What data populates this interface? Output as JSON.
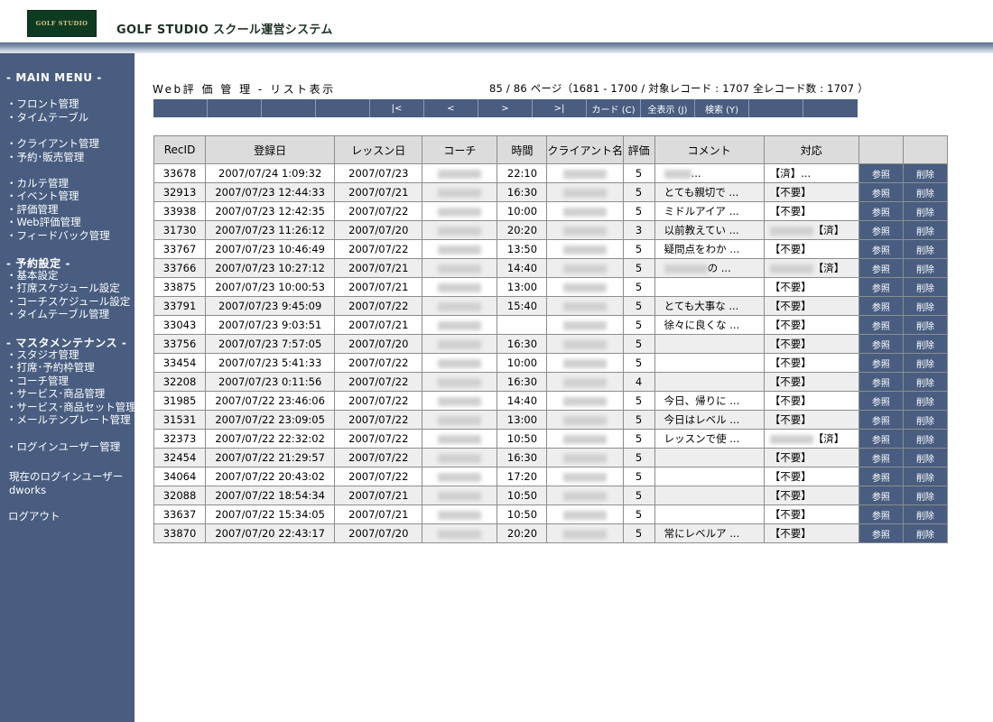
{
  "header": {
    "logo_text": "GOLF STUDIO",
    "app_title": "GOLF STUDIO スクール運営システム"
  },
  "sidebar": {
    "main_menu": "- MAIN MENU -",
    "group1": [
      "・フロント管理",
      "・タイムテーブル"
    ],
    "group2": [
      "・クライアント管理",
      "・予約･販売管理"
    ],
    "group3": [
      "・カルテ管理",
      "・イベント管理",
      "・評価管理",
      "・Web評価管理",
      "・フィードバック管理"
    ],
    "settings_head": "- 予約設定 -",
    "group4": [
      "・基本設定",
      "・打席スケジュール設定",
      "・コーチスケジュール設定",
      "・タイムテーブル管理"
    ],
    "master_head": "- マスタメンテナンス -",
    "group5": [
      "・スタジオ管理",
      "・打席･予約枠管理",
      "・コーチ管理",
      "・サービス･商品管理",
      "・サービス･商品セット管理",
      "・メールテンプレート管理"
    ],
    "login_user_mgmt": "・ログインユーザー管理",
    "current_user_label": "現在のログインユーザー",
    "current_user": "dworks",
    "logout": "ログアウト"
  },
  "main": {
    "title": "Web評 価 管 理 - リスト表示",
    "page_info": "85 / 86 ページ（1681 - 1700 / 対象レコード : 1707 全レコード数 : 1707 ）",
    "nav": [
      "",
      "",
      "",
      "",
      "|<",
      "<",
      ">",
      ">|",
      "カード (C)",
      "全表示 (J)",
      "検索 (Y)",
      "",
      ""
    ],
    "columns": [
      "RecID",
      "登録日",
      "レッスン日",
      "コーチ",
      "時間",
      "クライアント名",
      "評価",
      "コメント",
      "対応",
      "",
      ""
    ],
    "ref_label": "参照",
    "del_label": "削除",
    "rows": [
      {
        "id": "33678",
        "reg": "2007/07/24 1:09:32",
        "lesson": "2007/07/23",
        "time": "22:10",
        "rating": "5",
        "comment": "...",
        "action": "【済】..."
      },
      {
        "id": "32913",
        "reg": "2007/07/23 12:44:33",
        "lesson": "2007/07/21",
        "time": "16:30",
        "rating": "5",
        "comment": "とても親切で ...",
        "action": "【不要】"
      },
      {
        "id": "33938",
        "reg": "2007/07/23 12:42:35",
        "lesson": "2007/07/22",
        "time": "10:00",
        "rating": "5",
        "comment": "ミドルアイア ...",
        "action": "【不要】"
      },
      {
        "id": "31730",
        "reg": "2007/07/23 11:26:12",
        "lesson": "2007/07/20",
        "time": "20:20",
        "rating": "3",
        "comment": "以前教えてい ...",
        "action": "【済】"
      },
      {
        "id": "33767",
        "reg": "2007/07/23 10:46:49",
        "lesson": "2007/07/22",
        "time": "13:50",
        "rating": "5",
        "comment": "疑問点をわか ...",
        "action": "【不要】"
      },
      {
        "id": "33766",
        "reg": "2007/07/23 10:27:12",
        "lesson": "2007/07/21",
        "time": "14:40",
        "rating": "5",
        "comment": "の ...",
        "action": "【済】"
      },
      {
        "id": "33875",
        "reg": "2007/07/23 10:00:53",
        "lesson": "2007/07/21",
        "time": "13:00",
        "rating": "5",
        "comment": "",
        "action": "【不要】"
      },
      {
        "id": "33791",
        "reg": "2007/07/23 9:45:09",
        "lesson": "2007/07/22",
        "time": "15:40",
        "rating": "5",
        "comment": "とても大事な ...",
        "action": "【不要】"
      },
      {
        "id": "33043",
        "reg": "2007/07/23 9:03:51",
        "lesson": "2007/07/21",
        "time": "",
        "rating": "5",
        "comment": "徐々に良くな ...",
        "action": "【不要】"
      },
      {
        "id": "33756",
        "reg": "2007/07/23 7:57:05",
        "lesson": "2007/07/20",
        "time": "16:30",
        "rating": "5",
        "comment": "",
        "action": "【不要】"
      },
      {
        "id": "33454",
        "reg": "2007/07/23 5:41:33",
        "lesson": "2007/07/22",
        "time": "10:00",
        "rating": "5",
        "comment": "",
        "action": "【不要】"
      },
      {
        "id": "32208",
        "reg": "2007/07/23 0:11:56",
        "lesson": "2007/07/22",
        "time": "16:30",
        "rating": "4",
        "comment": "",
        "action": "【不要】"
      },
      {
        "id": "31985",
        "reg": "2007/07/22 23:46:06",
        "lesson": "2007/07/22",
        "time": "14:40",
        "rating": "5",
        "comment": "今日、帰りに ...",
        "action": "【不要】"
      },
      {
        "id": "31531",
        "reg": "2007/07/22 23:09:05",
        "lesson": "2007/07/22",
        "time": "13:00",
        "rating": "5",
        "comment": "今日はレベル ...",
        "action": "【不要】"
      },
      {
        "id": "32373",
        "reg": "2007/07/22 22:32:02",
        "lesson": "2007/07/22",
        "time": "10:50",
        "rating": "5",
        "comment": "レッスンで使 ...",
        "action": "【済】"
      },
      {
        "id": "32454",
        "reg": "2007/07/22 21:29:57",
        "lesson": "2007/07/22",
        "time": "16:30",
        "rating": "5",
        "comment": "",
        "action": "【不要】"
      },
      {
        "id": "34064",
        "reg": "2007/07/22 20:43:02",
        "lesson": "2007/07/22",
        "time": "17:20",
        "rating": "5",
        "comment": "",
        "action": "【不要】"
      },
      {
        "id": "32088",
        "reg": "2007/07/22 18:54:34",
        "lesson": "2007/07/21",
        "time": "10:50",
        "rating": "5",
        "comment": "",
        "action": "【不要】"
      },
      {
        "id": "33637",
        "reg": "2007/07/22 15:34:05",
        "lesson": "2007/07/21",
        "time": "10:50",
        "rating": "5",
        "comment": "",
        "action": "【不要】"
      },
      {
        "id": "33870",
        "reg": "2007/07/20 22:43:17",
        "lesson": "2007/07/20",
        "time": "20:20",
        "rating": "5",
        "comment": "常にレベルア ...",
        "action": "【不要】"
      }
    ]
  },
  "colors": {
    "sidebar_bg": "#485d80",
    "button_bg": "#485d80",
    "header_green": "#0f3a22"
  }
}
